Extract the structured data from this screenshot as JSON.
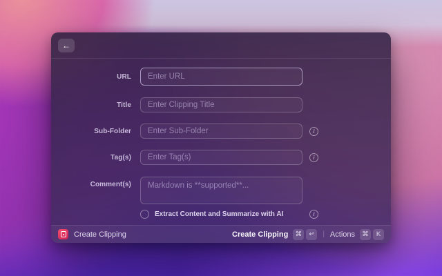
{
  "window": {
    "header": {
      "back_icon": "←"
    },
    "form": {
      "fields": [
        {
          "label": "URL",
          "placeholder": "Enter URL",
          "has_info": false,
          "focused": true
        },
        {
          "label": "Title",
          "placeholder": "Enter Clipping Title",
          "has_info": false,
          "focused": false
        },
        {
          "label": "Sub-Folder",
          "placeholder": "Enter Sub-Folder",
          "has_info": true,
          "focused": false
        },
        {
          "label": "Tag(s)",
          "placeholder": "Enter Tag(s)",
          "has_info": true,
          "focused": false
        },
        {
          "label": "Comment(s)",
          "placeholder": "Markdown is **supported**...",
          "has_info": false,
          "multiline": true
        }
      ],
      "checkbox": {
        "label": "Extract Content and Summarize with AI",
        "checked": false,
        "has_info": true
      }
    },
    "footer": {
      "app_name": "Create Clipping",
      "primary_action": {
        "label": "Create Clipping",
        "keys": [
          "⌘",
          "↵"
        ]
      },
      "secondary_action": {
        "label": "Actions",
        "keys": [
          "⌘",
          "K"
        ]
      },
      "divider": "|",
      "info_glyph": "i"
    }
  },
  "colors": {
    "accent_focus_border": "#e9e0ff",
    "app_icon_red": "#e03360",
    "window_tint": "#382850",
    "wallpaper_violet": "#5a2cc0",
    "wallpaper_pink": "#cc75a6"
  }
}
